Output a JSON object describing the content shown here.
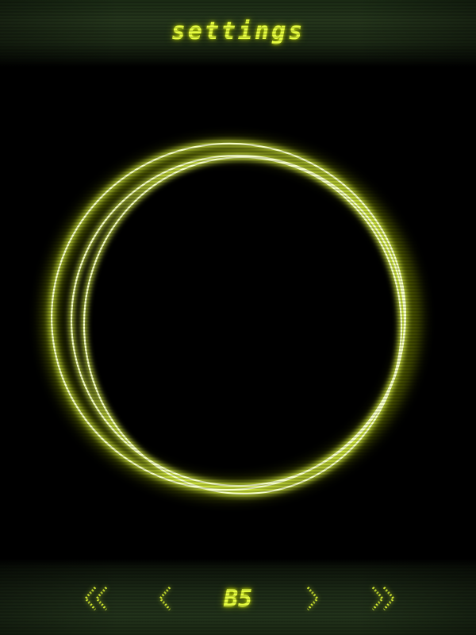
{
  "header": {
    "title": "settings"
  },
  "bottom_nav": {
    "first_icon": "double-chevron-left-icon",
    "prev_icon": "chevron-left-icon",
    "level": "B5",
    "next_icon": "chevron-right-icon",
    "last_icon": "double-chevron-right-icon"
  },
  "colors": {
    "accent": "#e8ff40",
    "ring_core": "#fbffd8",
    "ring_glow": "#c8e000",
    "bar_green": "#22331b",
    "background": "#000000"
  }
}
